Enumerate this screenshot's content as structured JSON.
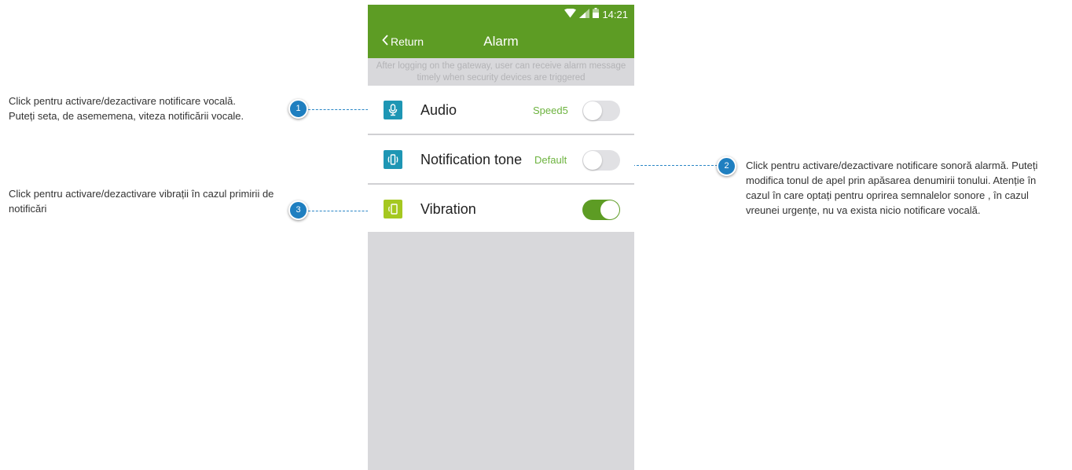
{
  "status_bar": {
    "time": "14:21",
    "icons": [
      "wifi-icon",
      "signal-icon",
      "battery-icon"
    ]
  },
  "nav": {
    "back_label": "Return",
    "title": "Alarm"
  },
  "info_banner": "After logging on the gateway, user can receive alarm message timely when security devices are triggered",
  "settings": [
    {
      "label": "Audio",
      "value": "Speed5",
      "enabled": false,
      "icon": "microphone-icon",
      "icon_color": "#1e96b4"
    },
    {
      "label": "Notification tone",
      "value": "Default",
      "enabled": false,
      "icon": "speaker-icon",
      "icon_color": "#1e96b4"
    },
    {
      "label": "Vibration",
      "value": "",
      "enabled": true,
      "icon": "vibrate-icon",
      "icon_color": "#a5c820"
    }
  ],
  "annotations": [
    {
      "number": "1",
      "text": "Click pentru activare/dezactivare notificare vocală. Puteți seta, de asememena, viteza notificării vocale."
    },
    {
      "number": "2",
      "text": "Click pentru activare/dezactivare notificare sonoră alarmă. Puteți modifica tonul de apel prin apăsarea denumirii tonului. Atenție în cazul în care optați pentru oprirea semnalelor sonore , în cazul vreunei urgențe, nu va exista nicio notificare vocală."
    },
    {
      "number": "3",
      "text": "Click pentru activare/dezactivare vibrații în cazul primirii de notificări"
    }
  ],
  "colors": {
    "header_green": "#5d9c24",
    "value_green": "#6db33f",
    "marker_blue": "#1f7fc0",
    "icon_teal": "#1e96b4",
    "icon_lime": "#a5c820"
  }
}
